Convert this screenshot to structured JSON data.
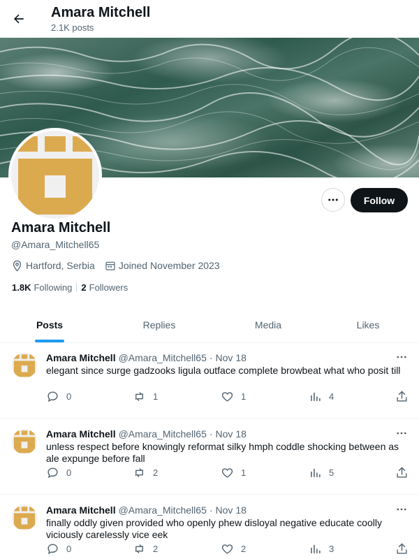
{
  "header": {
    "title": "Amara Mitchell",
    "post_count": "2.1K posts"
  },
  "profile": {
    "name": "Amara Mitchell",
    "handle": "@Amara_Mitchell65",
    "location": "Hartford, Serbia",
    "joined": "Joined November 2023",
    "following_count": "1.8K",
    "following_label": "Following",
    "followers_count": "2",
    "followers_label": "Followers",
    "follow_label": "Follow",
    "avatar_color": "#dcaa4e"
  },
  "tabs": [
    {
      "label": "Posts",
      "active": true
    },
    {
      "label": "Replies",
      "active": false
    },
    {
      "label": "Media",
      "active": false
    },
    {
      "label": "Likes",
      "active": false
    }
  ],
  "posts": [
    {
      "name": "Amara Mitchell",
      "handle": "@Amara_Mitchell65",
      "date": "Nov 18",
      "text": "elegant since surge gadzooks ligula outface complete browbeat what who posit till",
      "replies": "0",
      "reposts": "1",
      "likes": "1",
      "views": "4"
    },
    {
      "name": "Amara Mitchell",
      "handle": "@Amara_Mitchell65",
      "date": "Nov 18",
      "text": "unless respect before knowingly reformat silky hmph coddle shocking between as ale expunge before fall",
      "replies": "0",
      "reposts": "2",
      "likes": "1",
      "views": "5"
    },
    {
      "name": "Amara Mitchell",
      "handle": "@Amara_Mitchell65",
      "date": "Nov 18",
      "text": "finally oddly given provided who openly phew disloyal negative educate coolly viciously carelessly vice eek",
      "replies": "0",
      "reposts": "2",
      "likes": "2",
      "views": "3"
    }
  ],
  "colors": {
    "accent": "#1d9bf0",
    "text_primary": "#0f1419",
    "text_secondary": "#536471"
  }
}
